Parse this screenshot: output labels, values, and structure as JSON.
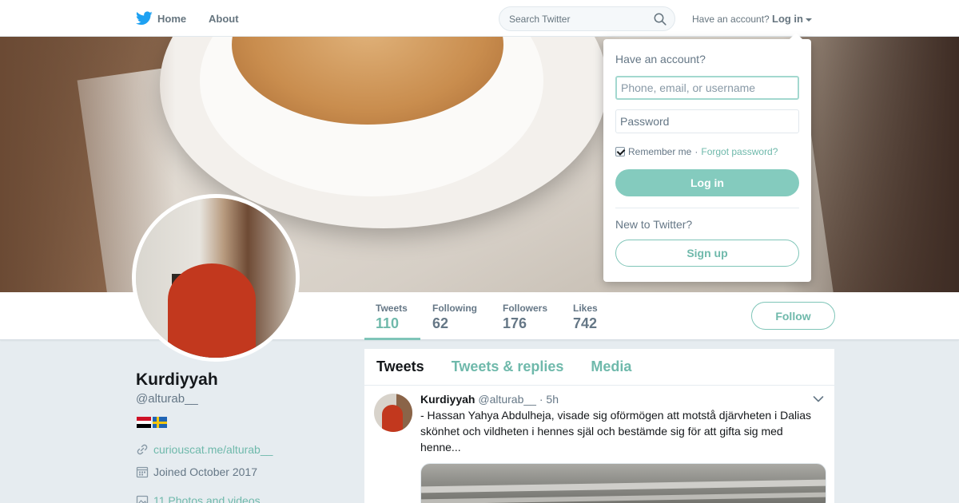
{
  "topbar": {
    "home_label": "Home",
    "about_label": "About",
    "search_placeholder": "Search Twitter",
    "account_prompt": "Have an account?",
    "login_label": "Log in"
  },
  "login_dropdown": {
    "title": "Have an account?",
    "username_placeholder": "Phone, email, or username",
    "password_placeholder": "Password",
    "remember_label": "Remember me",
    "separator": "·",
    "forgot_label": "Forgot password?",
    "login_button": "Log in",
    "new_prompt": "New to Twitter?",
    "signup_button": "Sign up"
  },
  "profile_nav": {
    "stats": [
      {
        "label": "Tweets",
        "value": "110"
      },
      {
        "label": "Following",
        "value": "62"
      },
      {
        "label": "Followers",
        "value": "176"
      },
      {
        "label": "Likes",
        "value": "742"
      }
    ],
    "follow_label": "Follow"
  },
  "profile": {
    "name": "Kurdiyyah",
    "handle": "@alturab__",
    "link": "curiouscat.me/alturab__",
    "joined": "Joined October 2017",
    "photos": "11 Photos and videos"
  },
  "timeline": {
    "tabs": [
      "Tweets",
      "Tweets & replies",
      "Media"
    ],
    "tweet": {
      "author": "Kurdiyyah",
      "handle": "@alturab__",
      "separator": "·",
      "time": "5h",
      "text": "- Hassan Yahya Abdulheja, visade sig oförmögen att motstå djärvheten i Dalias skönhet och vildheten i hennes själ och bestämde sig för att gifta sig med henne..."
    }
  },
  "colors": {
    "accent": "#6fb9ab",
    "accent_button": "#84cbbe",
    "background": "#e6ecf0",
    "twitter_blue": "#1da1f2"
  },
  "icons": [
    "bird-icon",
    "search-icon",
    "caret-down-icon",
    "link-icon",
    "calendar-icon",
    "photo-icon",
    "chevron-down-icon",
    "flag-iraq-icon",
    "flag-sweden-icon"
  ]
}
